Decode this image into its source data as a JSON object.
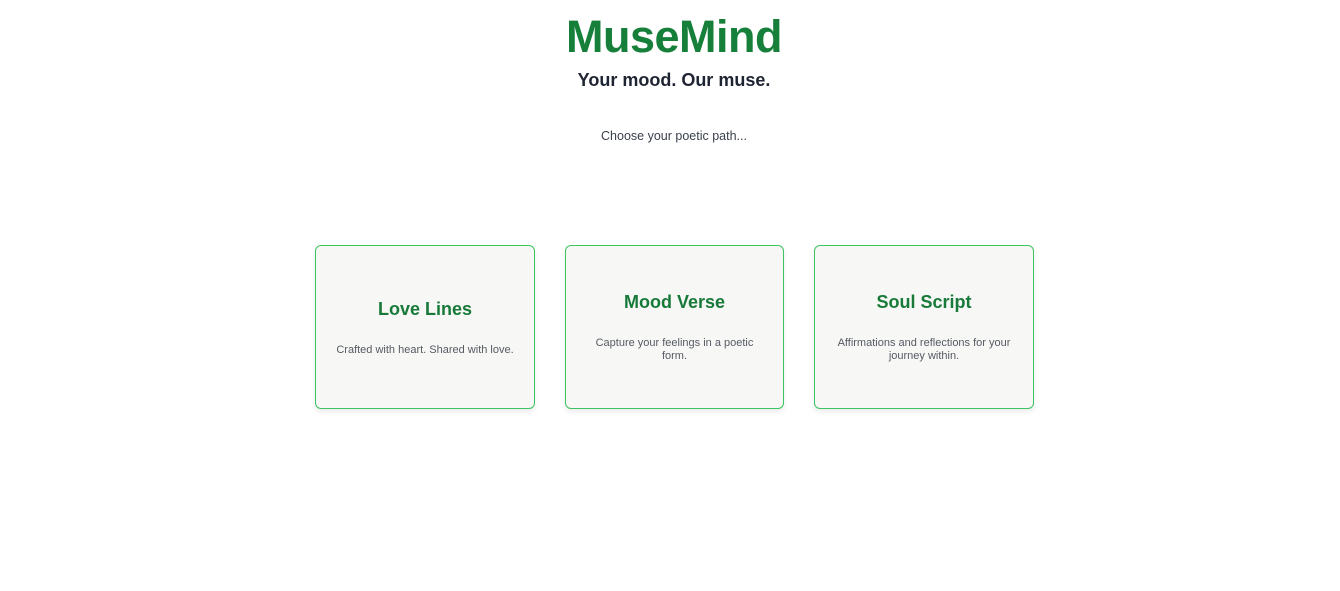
{
  "header": {
    "title": "MuseMind",
    "tagline": "Your mood. Our muse."
  },
  "prompt": "Choose your poetic path...",
  "cards": [
    {
      "title": "Love Lines",
      "description": "Crafted with heart. Shared with love."
    },
    {
      "title": "Mood Verse",
      "description": "Capture your feelings in a poetic form."
    },
    {
      "title": "Soul Script",
      "description": "Affirmations and reflections for your journey within."
    }
  ],
  "colors": {
    "brand": "#16803a",
    "card_border": "#3cc462",
    "card_background": "#f7f7f5",
    "tagline": "#1f2433"
  }
}
